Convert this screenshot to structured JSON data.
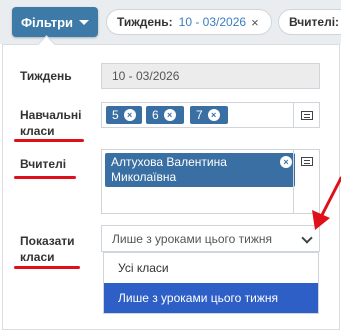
{
  "toolbar": {
    "filters_label": "Фільтри",
    "week_pill": {
      "label": "Тиждень:",
      "value": "10 - 03/2026",
      "remove": "×"
    },
    "teachers_pill": {
      "label": "Вчителі:"
    }
  },
  "form": {
    "week": {
      "label": "Тиждень",
      "value": "10 - 03/2026"
    },
    "classes": {
      "label_line1": "Навчальні",
      "label_line2": "класи",
      "chips": [
        {
          "text": "5",
          "remove": "×"
        },
        {
          "text": "6",
          "remove": "×"
        },
        {
          "text": "7",
          "remove": "×"
        }
      ]
    },
    "teachers": {
      "label": "Вчителі",
      "chips": [
        {
          "line1": "Алтухова Валентина",
          "line2": "Миколаївна",
          "remove": "×"
        }
      ]
    },
    "show_classes": {
      "label_line1": "Показати",
      "label_line2": "класи",
      "selected": "Лише з уроками цього тижня",
      "options": [
        {
          "text": "Усі класи",
          "selected": false
        },
        {
          "text": "Лише з уроками цього тижня",
          "selected": true
        }
      ]
    }
  },
  "colors": {
    "accent": "#3d7aa8",
    "chip": "#3a6fa3",
    "selected_option": "#2e5fc6",
    "annotation": "#e0101b"
  },
  "icons": [
    "chevron-down-icon",
    "close-icon",
    "list-icon"
  ]
}
